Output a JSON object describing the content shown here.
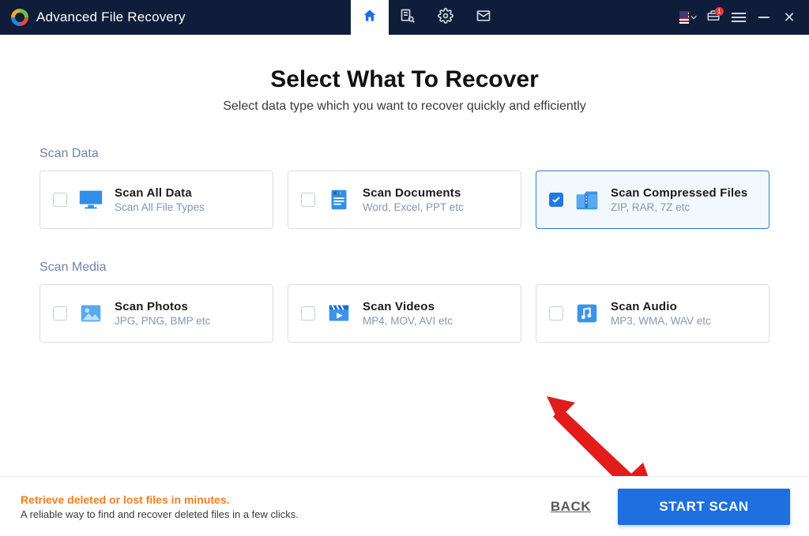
{
  "app": {
    "title": "Advanced File Recovery"
  },
  "titlebar": {
    "badge": "1"
  },
  "header": {
    "title": "Select What To Recover",
    "subtitle": "Select data type which you want to recover quickly and efficiently"
  },
  "sections": {
    "data_label": "Scan Data",
    "media_label": "Scan Media"
  },
  "cards": {
    "all": {
      "title": "Scan All Data",
      "sub": "Scan All File Types"
    },
    "docs": {
      "title": "Scan Documents",
      "sub": "Word, Excel, PPT etc"
    },
    "zip": {
      "title": "Scan Compressed Files",
      "sub": "ZIP, RAR, 7Z etc"
    },
    "photos": {
      "title": "Scan Photos",
      "sub": "JPG, PNG, BMP etc"
    },
    "videos": {
      "title": "Scan Videos",
      "sub": "MP4, MOV, AVI etc"
    },
    "audio": {
      "title": "Scan Audio",
      "sub": "MP3, WMA, WAV etc"
    }
  },
  "footer": {
    "promo_title": "Retrieve deleted or lost files in minutes.",
    "promo_sub": "A reliable way to find and recover deleted files in a few clicks.",
    "back": "BACK",
    "start": "START SCAN"
  }
}
